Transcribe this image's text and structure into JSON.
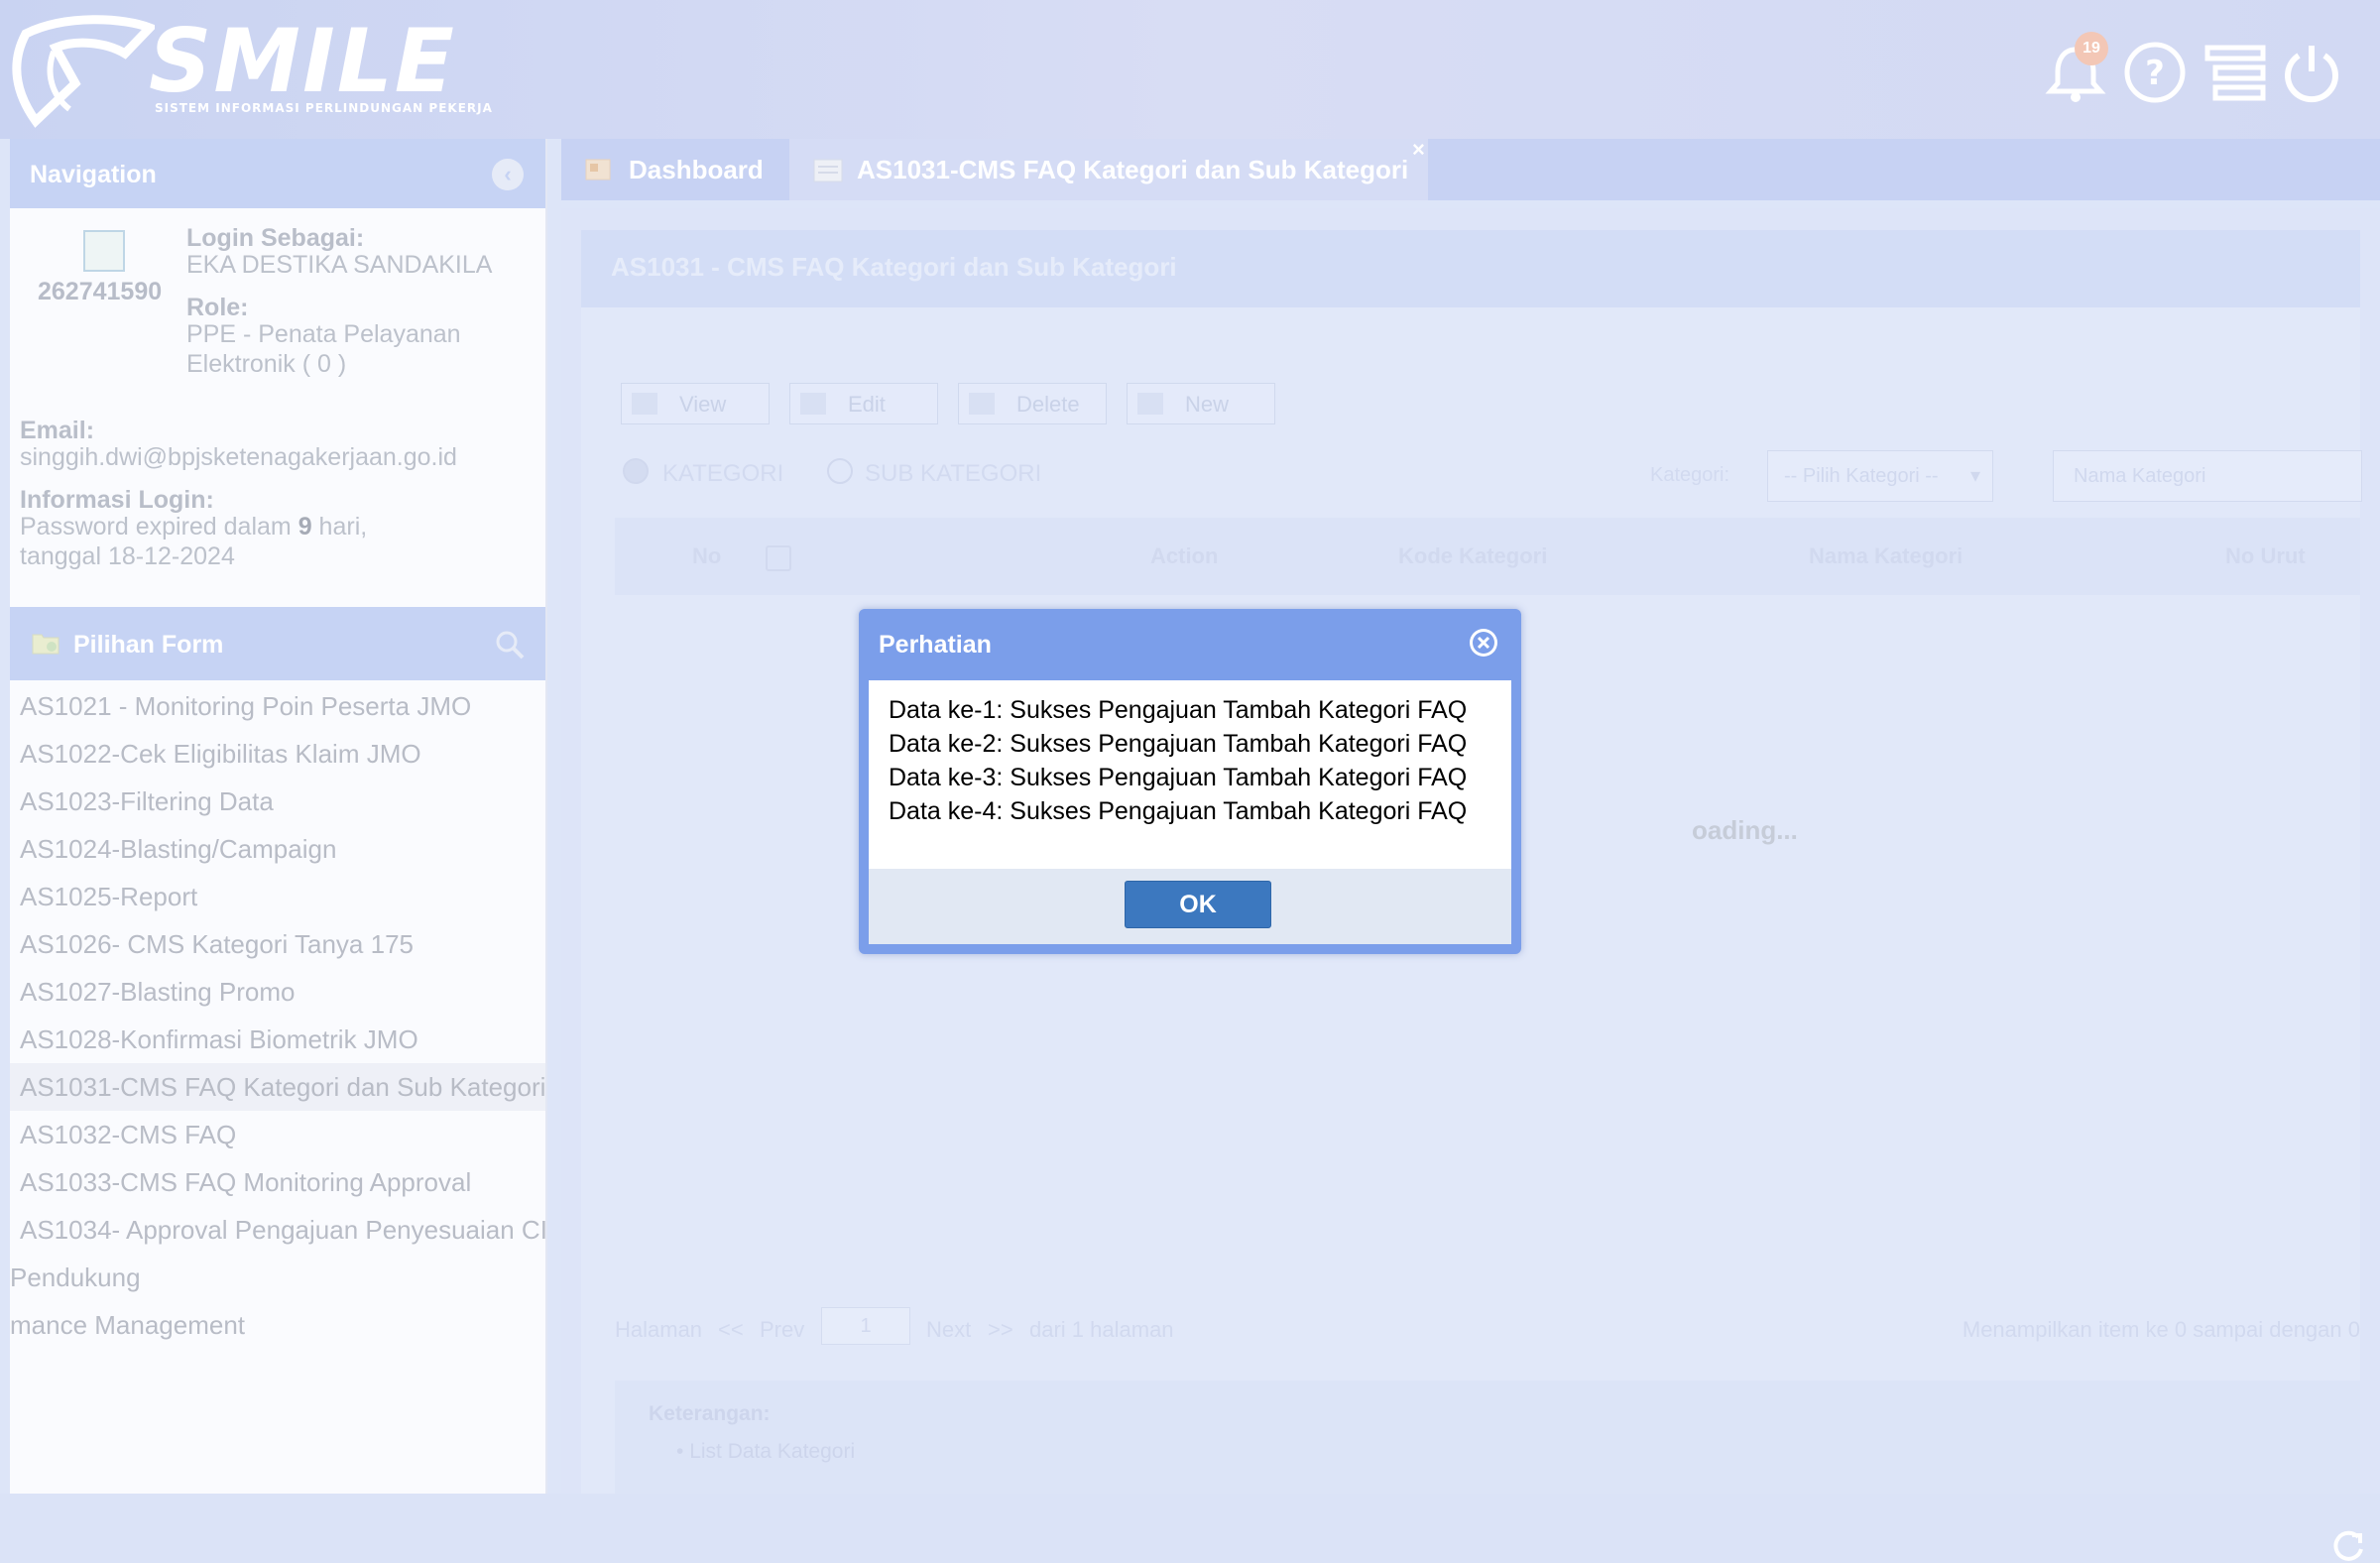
{
  "header": {
    "logo_text": "SMILE",
    "logo_subtitle": "SISTEM INFORMASI PERLINDUNGAN PEKERJA",
    "notification_count": "19",
    "icons": [
      "bell-icon",
      "help-icon",
      "menu-icon",
      "power-icon"
    ]
  },
  "navigation": {
    "title": "Navigation",
    "user_id": "262741590",
    "login_label": "Login Sebagai:",
    "login_value": "EKA DESTIKA SANDAKILA",
    "role_label": "Role:",
    "role_value_line1": "PPE - Penata Pelayanan",
    "role_value_line2": "Elektronik ( 0 )",
    "email_label": "Email:",
    "email_value": "singgih.dwi@bpjsketenagakerjaan.go.id",
    "info_label": "Informasi Login:",
    "info_line1_prefix": "Password expired dalam ",
    "info_line1_days": "9",
    "info_line1_suffix": " hari,",
    "info_line2": "tanggal 18-12-2024"
  },
  "pilihan_form": {
    "title": "Pilihan Form",
    "items": [
      "AS1021 - Monitoring Poin Peserta JMO",
      "AS1022-Cek Eligibilitas Klaim JMO",
      "AS1023-Filtering Data",
      "AS1024-Blasting/Campaign",
      "AS1025-Report",
      "AS1026- CMS Kategori Tanya 175",
      "AS1027-Blasting Promo",
      "AS1028-Konfirmasi Biometrik JMO",
      "AS1031-CMS FAQ Kategori dan Sub Kategori",
      "AS1032-CMS FAQ",
      "AS1033-CMS FAQ Monitoring Approval",
      "AS1034- Approval Pengajuan Penyesuaian CI",
      "Pendukung",
      "mance Management"
    ]
  },
  "tabs": [
    {
      "label": "Dashboard"
    },
    {
      "label": "AS1031-CMS FAQ Kategori dan Sub Kategori",
      "close": "×"
    }
  ],
  "panel": {
    "title": "AS1031 - CMS FAQ Kategori dan Sub Kategori",
    "buttons": [
      "View",
      "Edit",
      "Delete",
      "New"
    ],
    "radio_kategori": "KATEGORI",
    "radio_sub_kategori": "SUB KATEGORI",
    "kategori_label": "Kategori:",
    "kategori_select": "-- Pilih Kategori --",
    "nama_placeholder": "Nama Kategori",
    "columns": [
      "No",
      "Action",
      "Kode Kategori",
      "Nama Kategori",
      "No Urut"
    ],
    "loading": "oading...",
    "pager": {
      "halaman": "Halaman",
      "first": "<<",
      "prev": "Prev",
      "page": "1",
      "next": "Next",
      "last": ">>",
      "of": "dari 1 halaman",
      "summary": "Menampilkan item ke 0 sampai dengan 0"
    },
    "keterangan_label": "Keterangan:",
    "keterangan_item": "List Data Kategori"
  },
  "modal": {
    "title": "Perhatian",
    "messages": [
      "Data ke-1: Sukses Pengajuan Tambah Kategori FAQ",
      "Data ke-2: Sukses Pengajuan Tambah Kategori FAQ",
      "Data ke-3: Sukses Pengajuan Tambah Kategori FAQ",
      "Data ke-4: Sukses Pengajuan Tambah Kategori FAQ"
    ],
    "ok_label": "OK"
  },
  "colors": {
    "modal_header": "#7b9eea",
    "ok_button": "#3c78bf",
    "nav_header": "#c6d3f4",
    "overlay": "#dde5f8"
  }
}
